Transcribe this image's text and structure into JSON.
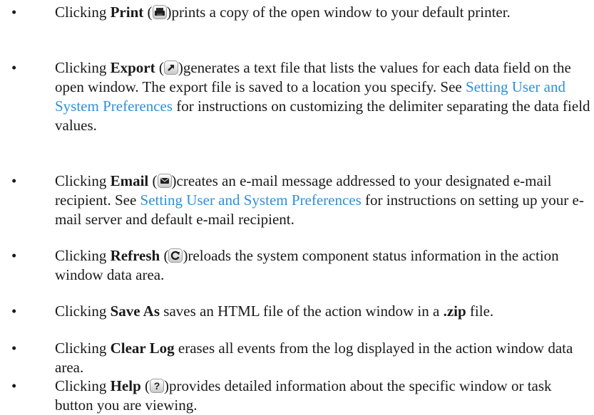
{
  "bullet_char": "•",
  "items": [
    {
      "pre": "Clicking ",
      "kw": "Print",
      "open": " (",
      "icon": "printer-icon",
      "after": ")prints a copy of the open window to your default printer."
    },
    {
      "pre": "Clicking ",
      "kw": "Export",
      "open": " (",
      "icon": "export-arrow-icon",
      "mid": ")generates a text file that lists the values for each data field on the open window. The export file is saved to a location you specify. See ",
      "link": "Setting User and System Preferences",
      "post": " for instructions on customizing the delimiter separating the data field values."
    },
    {
      "pre": "Clicking ",
      "kw": "Email",
      "open": " (",
      "icon": "envelope-icon",
      "mid": ")creates an e-mail message addressed to your designated e-mail recipient. See ",
      "link": "Setting User and System Preferences",
      "post": " for instructions on setting up your e-mail server and default e-mail recipient."
    },
    {
      "pre": "Clicking ",
      "kw": "Refresh",
      "open": " (",
      "icon": "refresh-icon",
      "after": ")reloads the system component status information in the action window data area."
    },
    {
      "pre": "Clicking ",
      "kw": "Save As",
      "mid": " saves an HTML file of the action window in a ",
      "kw2": ".zip",
      "post": " file."
    },
    {
      "pre": "Clicking ",
      "kw": "Clear Log",
      "post": " erases all events from the log displayed in the action window data area."
    },
    {
      "pre": "Clicking ",
      "kw": "Help",
      "open": " (",
      "icon": "help-question-icon",
      "after": ")provides detailed information about the specific window or task button you are viewing."
    }
  ],
  "colors": {
    "link": "#2e90d6",
    "text": "#1a1a1a"
  }
}
